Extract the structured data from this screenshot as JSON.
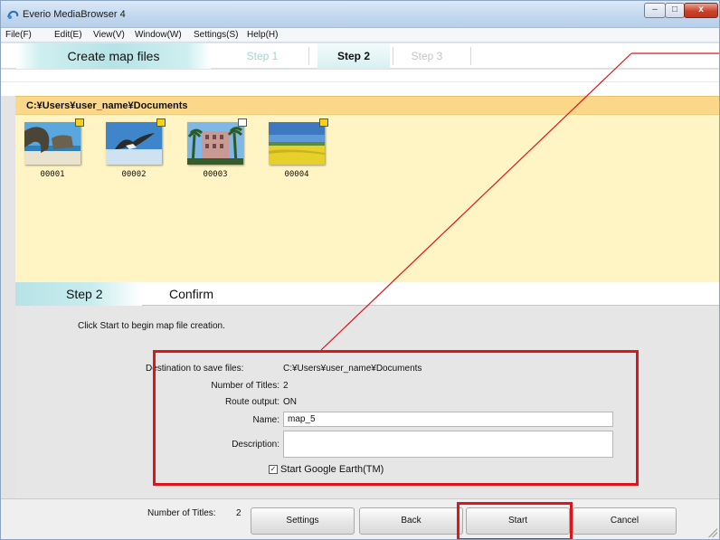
{
  "window": {
    "title": "Everio MediaBrowser 4",
    "controls": {
      "minimize": "–",
      "maximize": "□",
      "close": "x"
    }
  },
  "menu": [
    "File(F)",
    "Edit(E)",
    "View(V)",
    "Window(W)",
    "Settings(S)",
    "Help(H)"
  ],
  "stepbar": {
    "title": "Create map files",
    "steps": [
      "Step 1",
      "Step 2",
      "Step 3"
    ],
    "active_step": "Step 2"
  },
  "folder": {
    "path": "C:¥Users¥user_name¥Documents"
  },
  "thumbnails": [
    {
      "label": "00001",
      "badge": "yellow",
      "scene": "beach-rock"
    },
    {
      "label": "00002",
      "badge": "yellow",
      "scene": "bird-sky"
    },
    {
      "label": "00003",
      "badge": "white",
      "scene": "building-palms"
    },
    {
      "label": "00004",
      "badge": "yellow",
      "scene": "flower-field"
    }
  ],
  "confirm": {
    "step_label": "Step 2",
    "title": "Confirm",
    "instruction": "Click Start to begin map file creation."
  },
  "details": {
    "destination_label": "Destination to save files:",
    "destination_value": "C:¥Users¥user_name¥Documents",
    "titles_label": "Number of Titles:",
    "titles_value": "2",
    "route_label": "Route output:",
    "route_value": "ON",
    "name_label": "Name:",
    "name_value": "map_5",
    "description_label": "Description:",
    "description_value": "",
    "google_earth_label": "Start Google Earth(TM)",
    "google_earth_checked": true
  },
  "footer": {
    "count_label": "Number of Titles:",
    "count_value": "2",
    "buttons": {
      "settings": "Settings",
      "back": "Back",
      "start": "Start",
      "cancel": "Cancel"
    }
  },
  "colors": {
    "highlight": "#e0151b",
    "folder_bar": "#fbd889",
    "thumb_area": "#fff4c4",
    "step_accent": "#b5e3e6"
  }
}
